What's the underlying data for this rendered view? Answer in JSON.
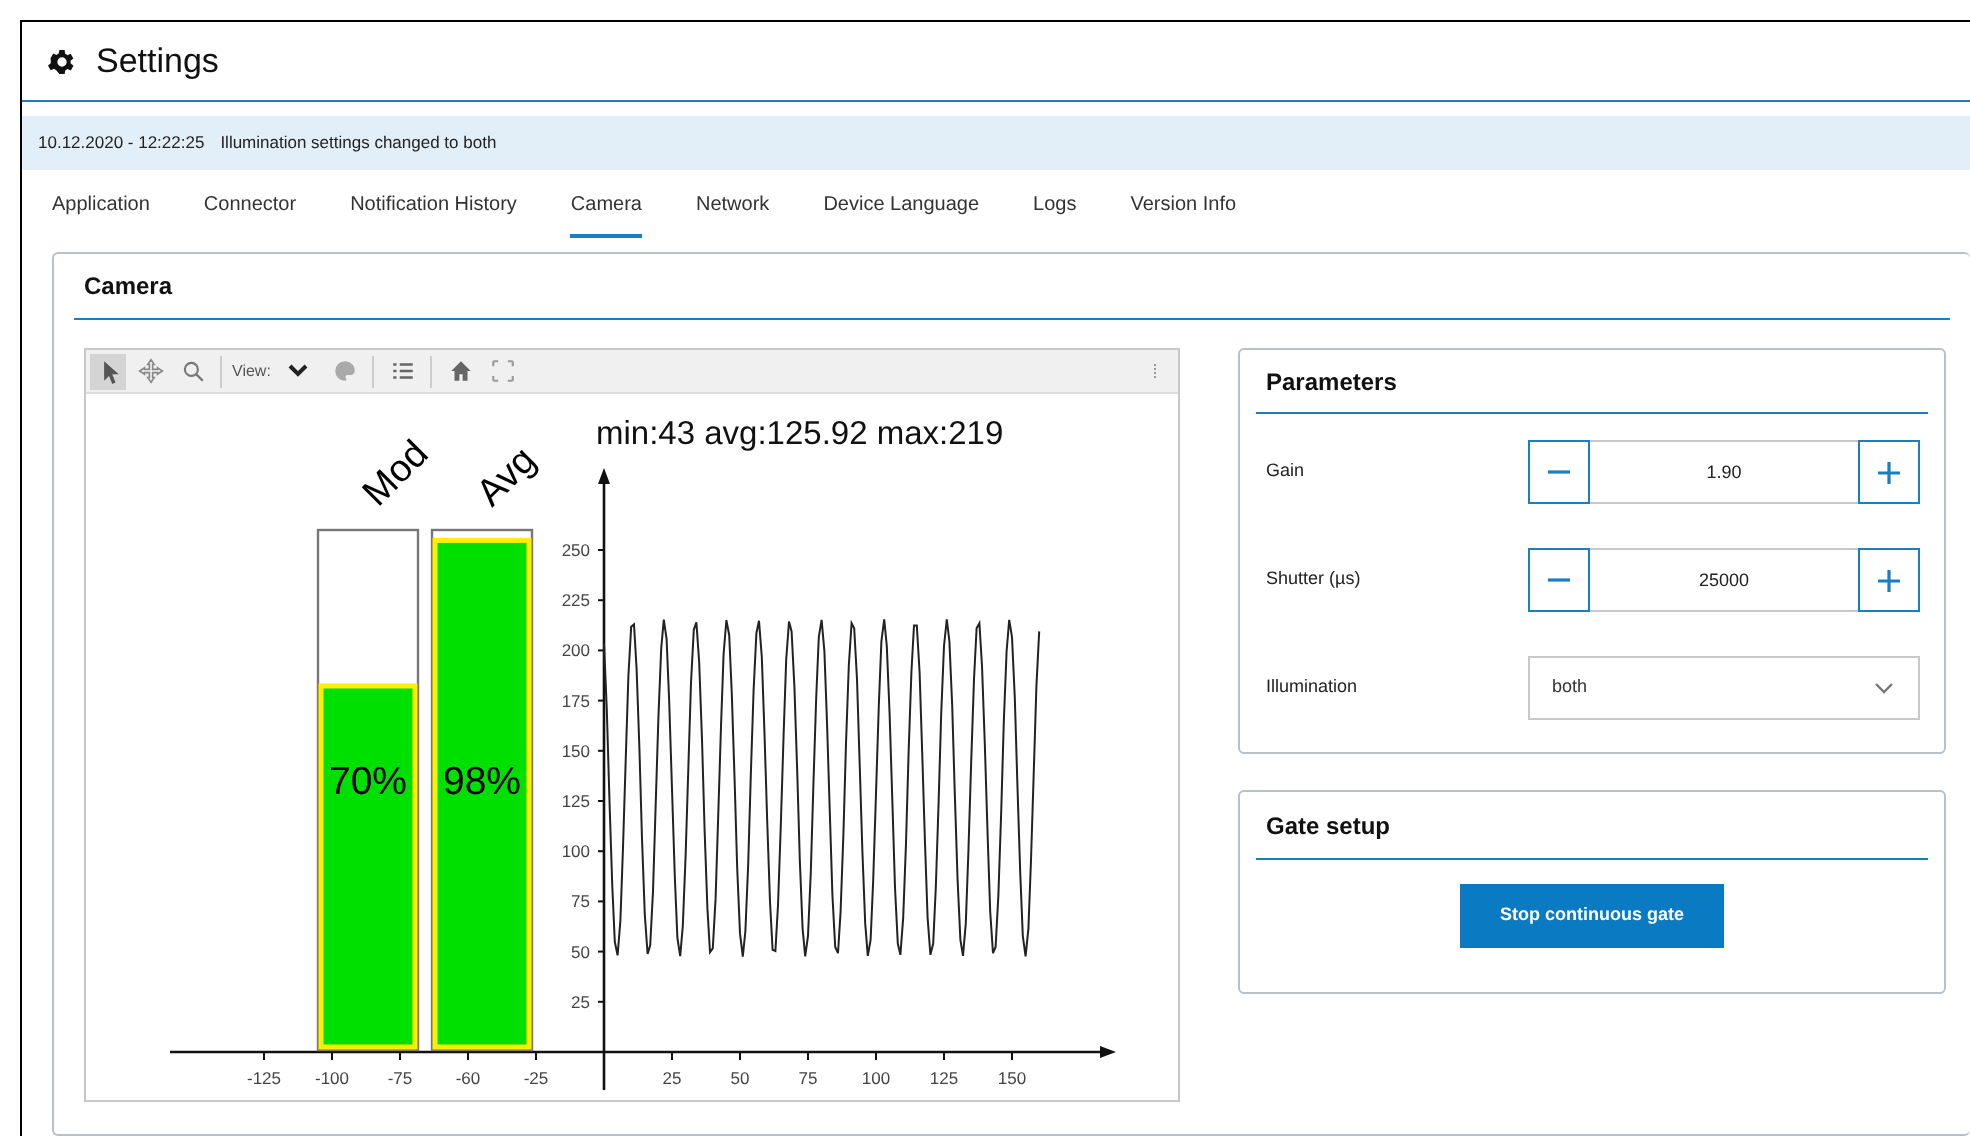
{
  "window": {
    "title": "Settings"
  },
  "notification": {
    "time": "10.12.2020 - 12:22:25",
    "message": "Illumination settings changed to both"
  },
  "tabs": [
    {
      "label": "Application",
      "selected": false
    },
    {
      "label": "Connector",
      "selected": false
    },
    {
      "label": "Notification History",
      "selected": false
    },
    {
      "label": "Camera",
      "selected": true
    },
    {
      "label": "Network",
      "selected": false
    },
    {
      "label": "Device Language",
      "selected": false
    },
    {
      "label": "Logs",
      "selected": false
    },
    {
      "label": "Version Info",
      "selected": false
    }
  ],
  "camera": {
    "title": "Camera",
    "toolbar": {
      "tools": [
        {
          "kind": "pointer",
          "selected": true
        },
        {
          "kind": "pan",
          "selected": false
        },
        {
          "kind": "zoom",
          "selected": false
        },
        {
          "kind": "separator"
        },
        {
          "kind": "view",
          "label": "View:"
        },
        {
          "kind": "palette",
          "selected": false
        },
        {
          "kind": "separator"
        },
        {
          "kind": "list",
          "selected": false
        },
        {
          "kind": "separator"
        },
        {
          "kind": "home",
          "selected": false
        },
        {
          "kind": "fullscreen",
          "selected": false
        }
      ]
    },
    "plot": {
      "stats": "min:43 avg:125.92 max:219",
      "bars": [
        {
          "name": "Mod",
          "level": 0.7,
          "reading": "70%"
        },
        {
          "name": "Avg",
          "level": 0.98,
          "reading": "98%"
        }
      ],
      "y_tick_labels": [
        "250",
        "225",
        "200",
        "175",
        "150",
        "125",
        "100",
        "75",
        "50",
        "25"
      ],
      "x_tick_labels_negative": [
        "-125",
        "-100",
        "-75",
        "-60",
        "-25"
      ],
      "x_tick_labels_positive": [
        "25",
        "50",
        "75",
        "100",
        "125",
        "150"
      ]
    }
  },
  "parameters": {
    "title": "Parameters",
    "rows": [
      {
        "kind": "stepper",
        "label": "Gain",
        "value": "1.90"
      },
      {
        "kind": "stepper",
        "label": "Shutter (µs)",
        "value": "25000"
      },
      {
        "kind": "select",
        "label": "Illumination",
        "value": "both"
      }
    ]
  },
  "gate_setup": {
    "title": "Gate setup",
    "button": "Stop continuous gate"
  }
}
